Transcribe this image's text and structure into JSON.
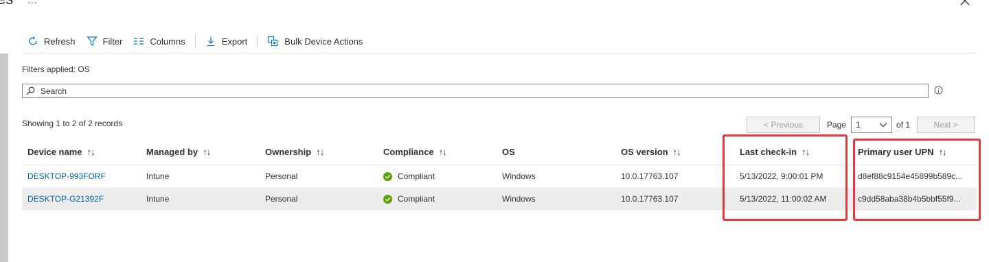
{
  "header": {
    "title_fragment": "es",
    "more": "..."
  },
  "toolbar": {
    "refresh": "Refresh",
    "filter": "Filter",
    "columns": "Columns",
    "export": "Export",
    "bulk": "Bulk Device Actions"
  },
  "filters_applied": "Filters applied: OS",
  "search": {
    "placeholder": "Search"
  },
  "records": "Showing 1 to 2 of 2 records",
  "pager": {
    "previous": "< Previous",
    "page_label": "Page",
    "page_value": "1",
    "of": "of 1",
    "next": "Next >"
  },
  "columns": [
    {
      "label": "Device name"
    },
    {
      "label": "Managed by"
    },
    {
      "label": "Ownership"
    },
    {
      "label": "Compliance"
    },
    {
      "label": "OS"
    },
    {
      "label": "OS version"
    },
    {
      "label": "Last check-in"
    },
    {
      "label": "Primary user UPN"
    }
  ],
  "sort_glyph": "↑↓",
  "rows": [
    {
      "device": "DESKTOP-993FORF",
      "managed": "Intune",
      "ownership": "Personal",
      "compliance": "Compliant",
      "os": "Windows",
      "os_version": "10.0.17763.107",
      "last_checkin": "5/13/2022, 9:00:01 PM",
      "upn": "d8ef88c9154e45899b589c..."
    },
    {
      "device": "DESKTOP-G21392F",
      "managed": "Intune",
      "ownership": "Personal",
      "compliance": "Compliant",
      "os": "Windows",
      "os_version": "10.0.17763.107",
      "last_checkin": "5/13/2022, 11:00:02 AM",
      "upn": "c9dd58aba38b4b5bbf55f9..."
    }
  ],
  "colors": {
    "link": "#0062ad",
    "compliant": "#57a300",
    "highlight": "#e0393e"
  }
}
